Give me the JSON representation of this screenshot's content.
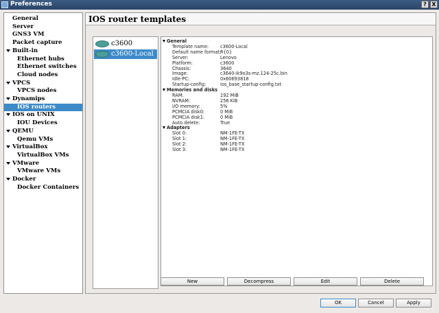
{
  "window": {
    "title": "Preferences",
    "help_label": "?",
    "close_label": "X"
  },
  "sidebar": {
    "items": [
      {
        "label": "General",
        "type": "cat"
      },
      {
        "label": "Server",
        "type": "cat"
      },
      {
        "label": "GNS3 VM",
        "type": "cat"
      },
      {
        "label": "Packet capture",
        "type": "cat"
      },
      {
        "label": "Built-in",
        "type": "cat",
        "expanded": true
      },
      {
        "label": "Ethernet hubs",
        "type": "child"
      },
      {
        "label": "Ethernet switches",
        "type": "child"
      },
      {
        "label": "Cloud nodes",
        "type": "child"
      },
      {
        "label": "VPCS",
        "type": "cat",
        "expanded": true
      },
      {
        "label": "VPCS nodes",
        "type": "child"
      },
      {
        "label": "Dynamips",
        "type": "cat",
        "expanded": true
      },
      {
        "label": "IOS routers",
        "type": "child",
        "selected": true
      },
      {
        "label": "IOS on UNIX",
        "type": "cat",
        "expanded": true
      },
      {
        "label": "IOU Devices",
        "type": "child"
      },
      {
        "label": "QEMU",
        "type": "cat",
        "expanded": true
      },
      {
        "label": "Qemu VMs",
        "type": "child"
      },
      {
        "label": "VirtualBox",
        "type": "cat",
        "expanded": true
      },
      {
        "label": "VirtualBox VMs",
        "type": "child"
      },
      {
        "label": "VMware",
        "type": "cat",
        "expanded": true
      },
      {
        "label": "VMware VMs",
        "type": "child"
      },
      {
        "label": "Docker",
        "type": "cat",
        "expanded": true
      },
      {
        "label": "Docker Containers",
        "type": "child"
      }
    ]
  },
  "main": {
    "title": "IOS router templates",
    "templates": [
      {
        "label": "c3600",
        "selected": false
      },
      {
        "label": "c3600-Local",
        "selected": true
      }
    ],
    "sections": [
      {
        "heading": "General",
        "rows": [
          {
            "k": "Template name:",
            "v": "c3600-Local"
          },
          {
            "k": "Default name format:",
            "v": "R{0}"
          },
          {
            "k": "Server:",
            "v": "Lenovo"
          },
          {
            "k": "Platform:",
            "v": "c3600"
          },
          {
            "k": "Chassis:",
            "v": "3640"
          },
          {
            "k": "Image:",
            "v": "c3640-ik9o3s-mz.124-25c.bin"
          },
          {
            "k": "Idle-PC:",
            "v": "0x60693818"
          },
          {
            "k": "Startup-config:",
            "v": "ios_base_startup-config.txt"
          }
        ]
      },
      {
        "heading": "Memories and disks",
        "rows": [
          {
            "k": "RAM:",
            "v": "192 MiB"
          },
          {
            "k": "NVRAM:",
            "v": "256 KiB"
          },
          {
            "k": "I/O memory:",
            "v": "5%"
          },
          {
            "k": "PCMCIA disk0:",
            "v": "0 MiB"
          },
          {
            "k": "PCMCIA disk1:",
            "v": "0 MiB"
          },
          {
            "k": "Auto delete:",
            "v": "True"
          }
        ]
      },
      {
        "heading": "Adapters",
        "rows": [
          {
            "k": "Slot 0:",
            "v": "NM-1FE-TX"
          },
          {
            "k": "Slot 1:",
            "v": "NM-1FE-TX"
          },
          {
            "k": "Slot 2:",
            "v": "NM-1FE-TX"
          },
          {
            "k": "Slot 3:",
            "v": "NM-1FE-TX"
          }
        ]
      }
    ],
    "buttons": [
      "New",
      "Decompress",
      "Edit",
      "Delete"
    ]
  },
  "dialog_buttons": [
    "OK",
    "Cancel",
    "Apply"
  ]
}
